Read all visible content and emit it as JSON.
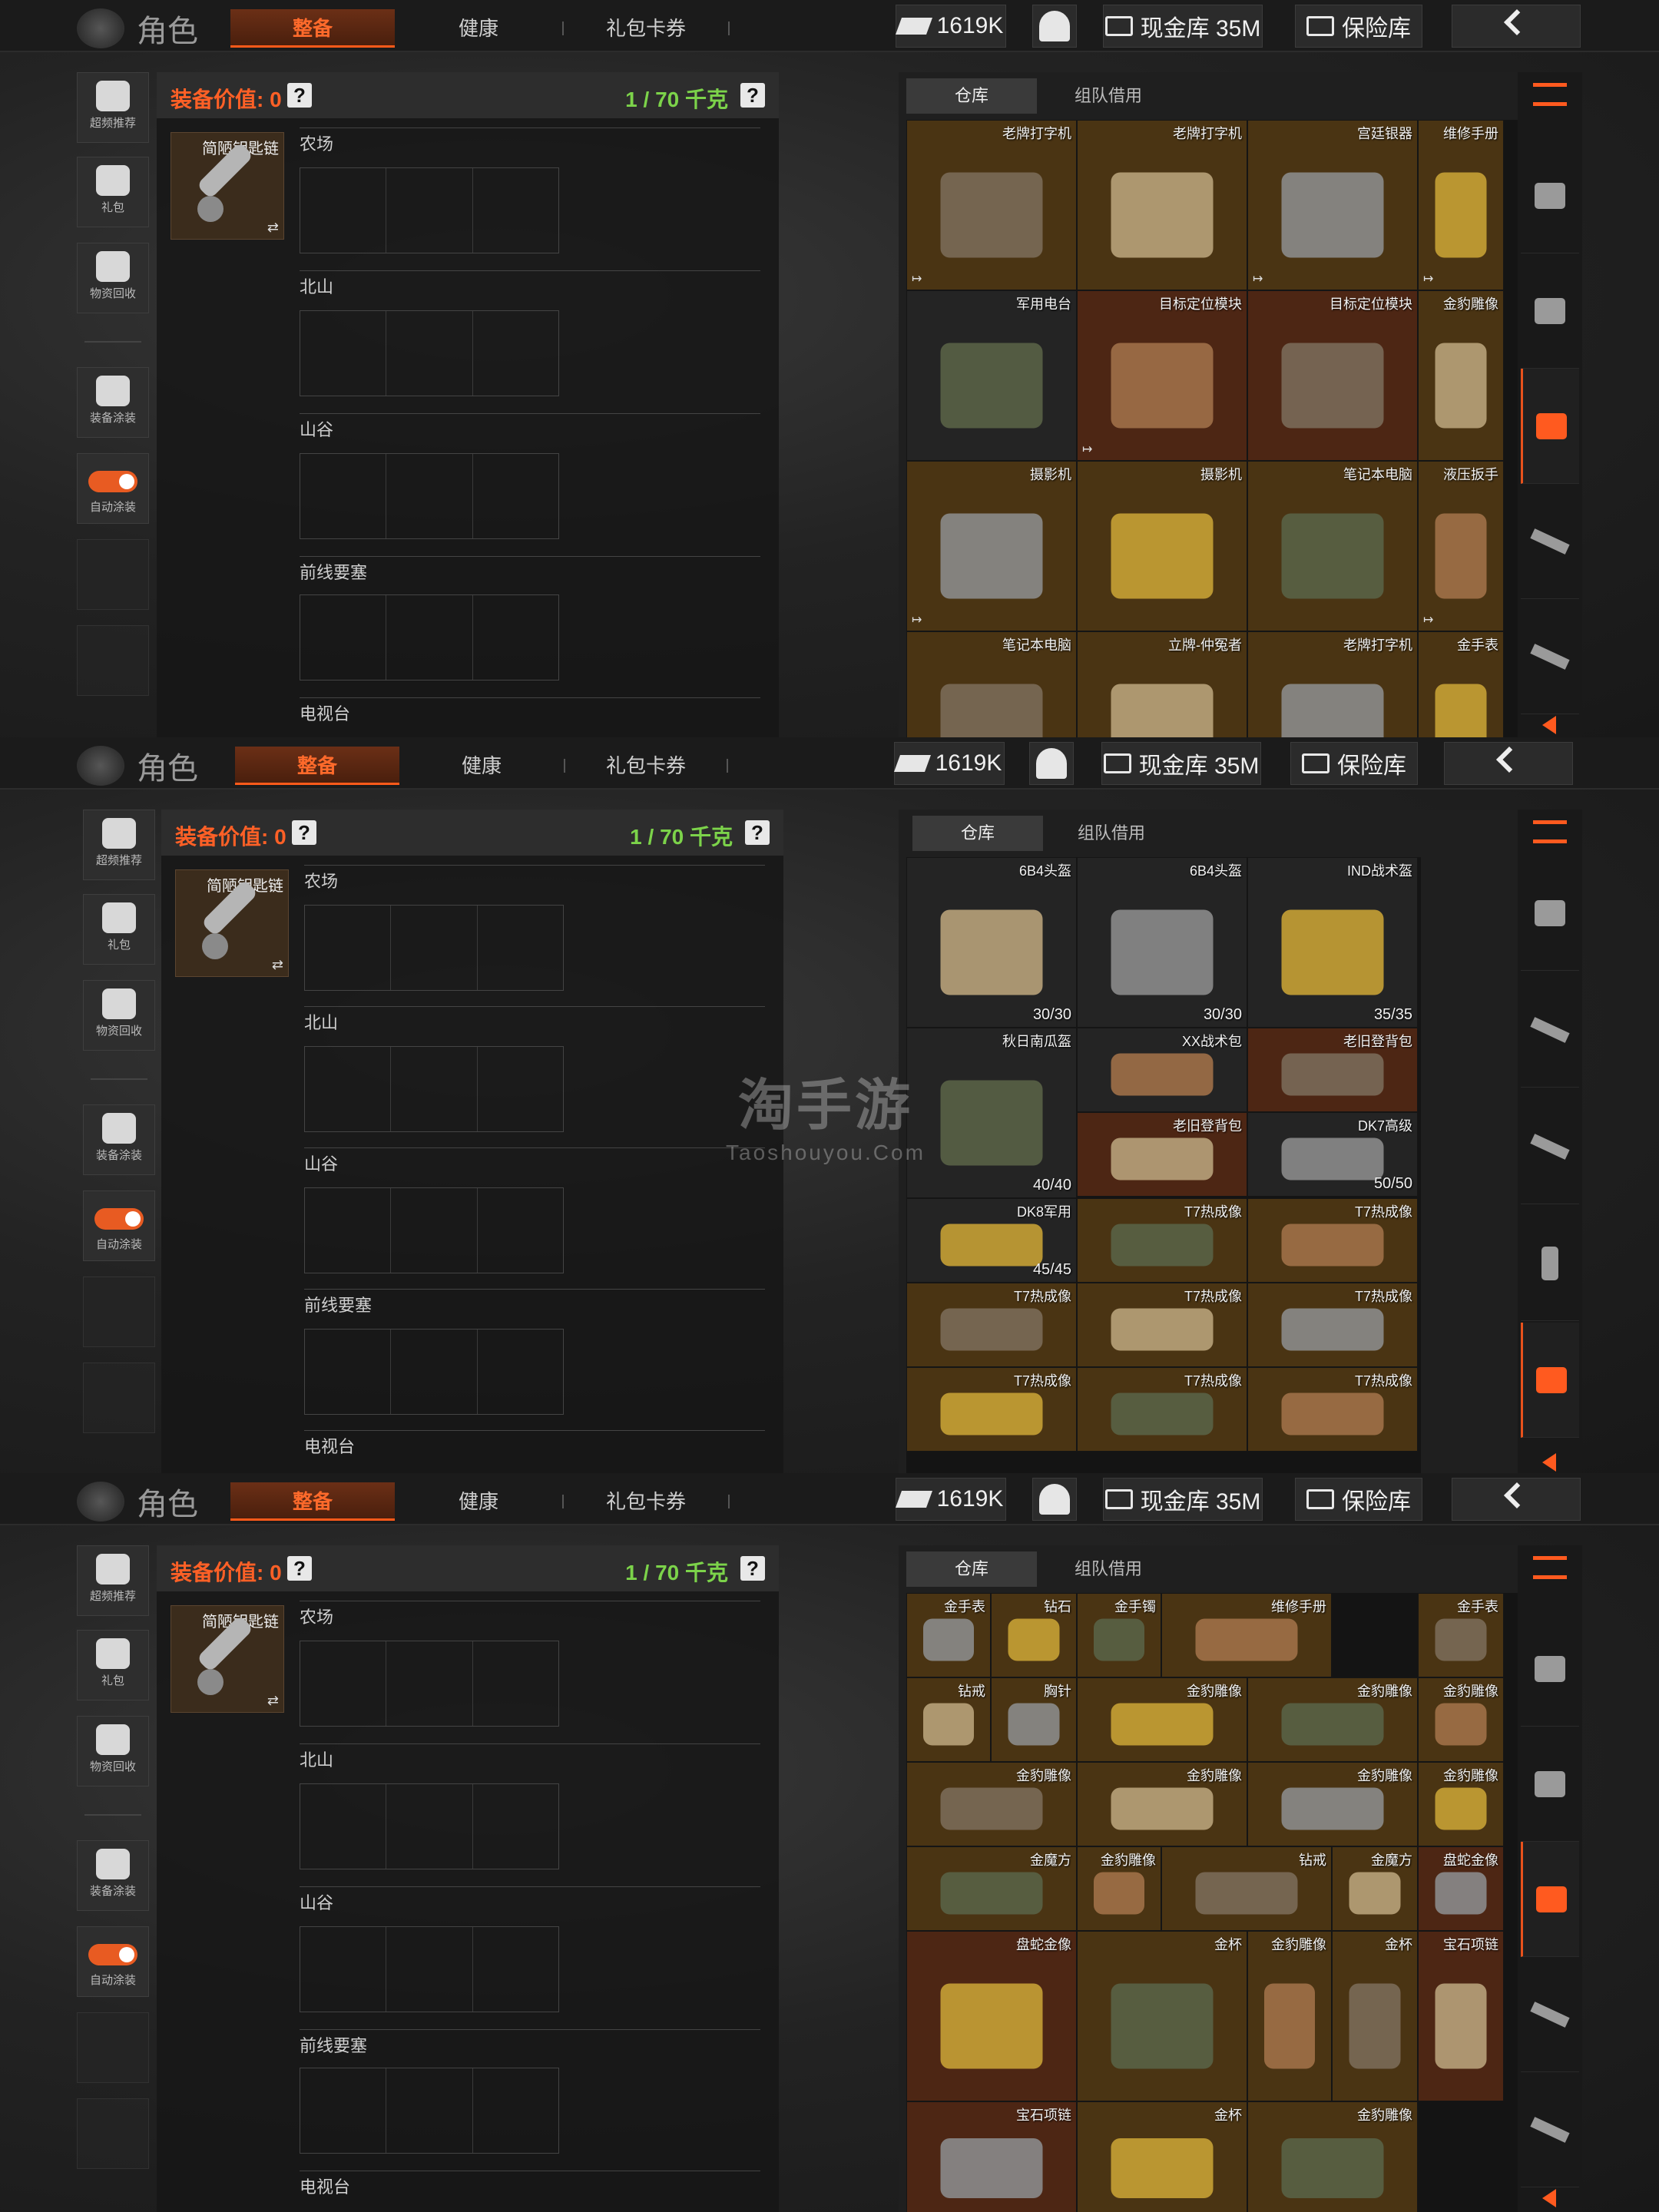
{
  "topbar": {
    "brand": "角色",
    "tabs": [
      "整备",
      "健康",
      "礼包卡券"
    ],
    "money": "1619K",
    "cash_vault": "现金库 35M",
    "safe": "保险库"
  },
  "sidebar": {
    "items": [
      "超频推荐",
      "礼包",
      "物资回收",
      "装备涂装",
      "自动涂装"
    ]
  },
  "equipment": {
    "value_label": "装备价值: 0",
    "weight_label": "1 / 70 千克",
    "question": "?",
    "key_item": "简陋钥匙链",
    "swap_icon": "⇄",
    "zones": [
      "农场",
      "北山",
      "山谷",
      "前线要塞",
      "电视台"
    ]
  },
  "inventory": {
    "tabs": [
      "仓库",
      "组队借用"
    ]
  },
  "watermark": {
    "line1": "淘手游",
    "line2": "Taoshouyou.Com"
  },
  "panels": [
    {
      "cells": [
        {
          "name": "老牌打字机",
          "tone": "brown",
          "marker": "↦"
        },
        {
          "name": "老牌打字机",
          "tone": "brown",
          "marker": ""
        },
        {
          "name": "宫廷银器",
          "tone": "brown",
          "marker": "↦"
        },
        {
          "name": "维修手册",
          "tone": "brown",
          "marker": "↦"
        },
        {
          "name": "军用电台",
          "tone": "dark",
          "marker": ""
        },
        {
          "name": "目标定位模块",
          "tone": "red",
          "marker": "↦"
        },
        {
          "name": "目标定位模块",
          "tone": "red",
          "marker": ""
        },
        {
          "name": "金豹雕像",
          "tone": "brown",
          "marker": ""
        },
        {
          "name": "摄影机",
          "tone": "brown",
          "marker": "↦"
        },
        {
          "name": "摄影机",
          "tone": "brown",
          "marker": ""
        },
        {
          "name": "笔记本电脑",
          "tone": "brown",
          "marker": ""
        },
        {
          "name": "液压扳手",
          "tone": "brown",
          "marker": "↦"
        },
        {
          "name": "笔记本电脑",
          "tone": "brown",
          "marker": ""
        },
        {
          "name": "立牌-仲冤者",
          "tone": "brown",
          "marker": ""
        },
        {
          "name": "老牌打字机",
          "tone": "brown",
          "marker": ""
        },
        {
          "name": "金手表",
          "tone": "brown",
          "marker": ""
        }
      ]
    },
    {
      "cells": [
        {
          "name": "6B4头盔",
          "tone": "dark",
          "dur": "30/30"
        },
        {
          "name": "6B4头盔",
          "tone": "dark",
          "dur": "30/30"
        },
        {
          "name": "IND战术盔",
          "tone": "dark",
          "dur": "35/35"
        },
        {
          "name": "秋日南瓜盔",
          "tone": "dark",
          "dur": "40/40"
        },
        {
          "name": "XX战术包",
          "tone": "dark",
          "dur": ""
        },
        {
          "name": "老旧登背包",
          "tone": "red",
          "dur": ""
        },
        {
          "name": "老旧登背包",
          "tone": "red",
          "dur": ""
        },
        {
          "name": "DK7高级",
          "tone": "dark",
          "dur": "50/50"
        },
        {
          "name": "DK8军用",
          "tone": "dark",
          "dur": "45/45"
        },
        {
          "name": "T7热成像",
          "tone": "brown",
          "dur": ""
        },
        {
          "name": "T7热成像",
          "tone": "brown",
          "dur": ""
        },
        {
          "name": "T7热成像",
          "tone": "brown",
          "dur": ""
        },
        {
          "name": "T7热成像",
          "tone": "brown",
          "dur": ""
        },
        {
          "name": "T7热成像",
          "tone": "brown",
          "dur": ""
        },
        {
          "name": "T7热成像",
          "tone": "brown",
          "dur": ""
        },
        {
          "name": "T7热成像",
          "tone": "brown",
          "dur": ""
        },
        {
          "name": "T7热成像",
          "tone": "brown",
          "dur": ""
        }
      ]
    },
    {
      "cells": [
        {
          "name": "金手表",
          "tone": "brown"
        },
        {
          "name": "钻石",
          "tone": "brown"
        },
        {
          "name": "金手镯",
          "tone": "brown"
        },
        {
          "name": "维修手册",
          "tone": "brown"
        },
        {
          "name": "金手表",
          "tone": "brown"
        },
        {
          "name": "钻戒",
          "tone": "brown"
        },
        {
          "name": "胸针",
          "tone": "brown"
        },
        {
          "name": "金豹雕像",
          "tone": "brown"
        },
        {
          "name": "金豹雕像",
          "tone": "brown"
        },
        {
          "name": "金豹雕像",
          "tone": "brown"
        },
        {
          "name": "金豹雕像",
          "tone": "brown"
        },
        {
          "name": "金豹雕像",
          "tone": "brown"
        },
        {
          "name": "金豹雕像",
          "tone": "brown"
        },
        {
          "name": "金豹雕像",
          "tone": "brown"
        },
        {
          "name": "金魔方",
          "tone": "brown"
        },
        {
          "name": "金豹雕像",
          "tone": "brown"
        },
        {
          "name": "钻戒",
          "tone": "brown"
        },
        {
          "name": "金魔方",
          "tone": "brown"
        },
        {
          "name": "盘蛇金像",
          "tone": "red"
        },
        {
          "name": "盘蛇金像",
          "tone": "red"
        },
        {
          "name": "金杯",
          "tone": "brown"
        },
        {
          "name": "金豹雕像",
          "tone": "brown"
        },
        {
          "name": "金杯",
          "tone": "brown"
        },
        {
          "name": "宝石项链",
          "tone": "red"
        },
        {
          "name": "宝石项链",
          "tone": "red"
        },
        {
          "name": "金杯",
          "tone": "brown"
        },
        {
          "name": "金豹雕像",
          "tone": "brown"
        }
      ]
    }
  ]
}
